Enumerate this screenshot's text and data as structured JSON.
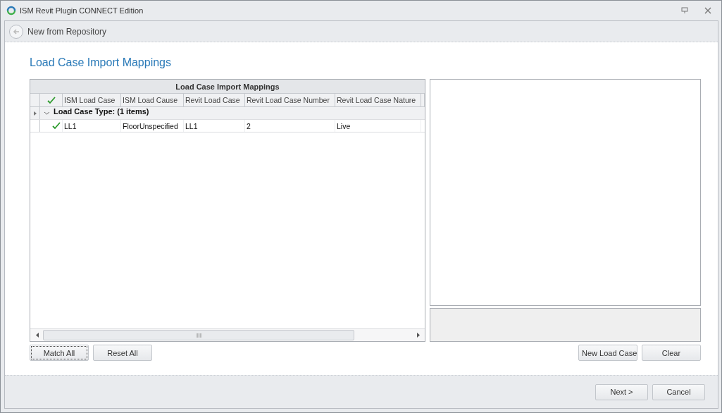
{
  "window": {
    "title": "ISM Revit Plugin CONNECT Edition"
  },
  "nav": {
    "title": "New from Repository"
  },
  "page_title": "Load Case Import Mappings",
  "grid": {
    "caption": "Load Case Import Mappings",
    "columns": [
      "ISM Load Case",
      "ISM Load Cause",
      "Revit Load Case",
      "Revit Load Case Number",
      "Revit Load Case Nature"
    ],
    "group": {
      "label": "Load Case Type:  (1 items)",
      "expanded": true
    },
    "rows": [
      {
        "matched": true,
        "cells": [
          "LL1",
          "FloorUnspecified",
          "LL1",
          "2",
          "Live"
        ]
      }
    ]
  },
  "left_buttons": [
    {
      "label": "Match All",
      "focused": true
    },
    {
      "label": "Reset All",
      "focused": false
    }
  ],
  "right_buttons": [
    {
      "label": "New Load Case"
    },
    {
      "label": "Clear"
    }
  ],
  "footer_buttons": [
    {
      "label": "Next >"
    },
    {
      "label": "Cancel"
    }
  ]
}
